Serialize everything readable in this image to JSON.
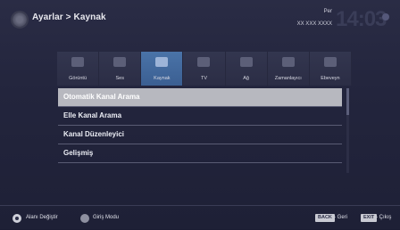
{
  "header": {
    "breadcrumb": "Ayarlar > Kaynak",
    "day": "Per",
    "date": "XX XXX XXXX",
    "time": "14:03"
  },
  "categories": [
    {
      "label": "Görüntü",
      "icon": "picture-icon",
      "active": false
    },
    {
      "label": "Ses",
      "icon": "speaker-icon",
      "active": false
    },
    {
      "label": "Kaynak",
      "icon": "source-icon",
      "active": true
    },
    {
      "label": "TV",
      "icon": "tv-icon",
      "active": false
    },
    {
      "label": "Ağ",
      "icon": "network-icon",
      "active": false
    },
    {
      "label": "Zamanlayıcı",
      "icon": "timer-icon",
      "active": false
    },
    {
      "label": "Ebeveyn",
      "icon": "parental-icon",
      "active": false
    }
  ],
  "menu": [
    {
      "label": "Otomatik Kanal Arama",
      "selected": true
    },
    {
      "label": "Elle Kanal Arama",
      "selected": false
    },
    {
      "label": "Kanal Düzenleyici",
      "selected": false
    },
    {
      "label": "Gelişmiş",
      "selected": false
    }
  ],
  "footer": {
    "nav_label": "Alanı Değiştir",
    "ok_label": "Giriş Modu",
    "back_key": "BACK",
    "back_label": "- Geri",
    "exit_key": "EXIT",
    "exit_label": "- Çıkış"
  },
  "colors": {
    "background": "#23253d",
    "active_tab": "#4a73a8",
    "selected_row": "#b7b8bf"
  }
}
